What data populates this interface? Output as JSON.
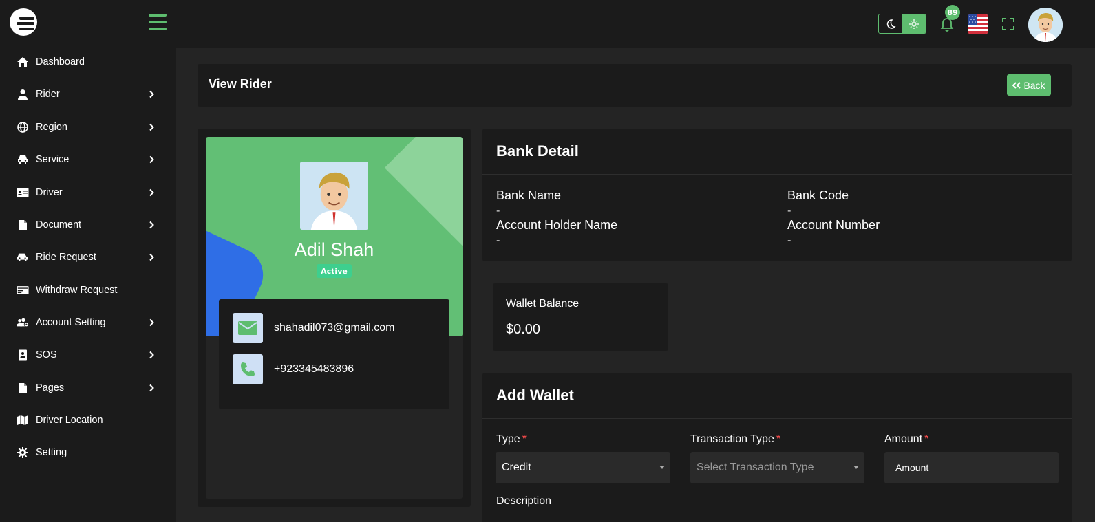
{
  "header": {
    "notification_count": "89",
    "language": "English (US)"
  },
  "sidebar": {
    "items": [
      {
        "label": "Dashboard",
        "icon": "home-icon",
        "has_submenu": false
      },
      {
        "label": "Rider",
        "icon": "user-icon",
        "has_submenu": true
      },
      {
        "label": "Region",
        "icon": "globe-icon",
        "has_submenu": true
      },
      {
        "label": "Service",
        "icon": "car-icon",
        "has_submenu": true
      },
      {
        "label": "Driver",
        "icon": "id-card-icon",
        "has_submenu": true
      },
      {
        "label": "Document",
        "icon": "file-icon",
        "has_submenu": true
      },
      {
        "label": "Ride Request",
        "icon": "taxi-icon",
        "has_submenu": true
      },
      {
        "label": "Withdraw Request",
        "icon": "money-icon",
        "has_submenu": false
      },
      {
        "label": "Account Setting",
        "icon": "users-gear-icon",
        "has_submenu": true
      },
      {
        "label": "SOS",
        "icon": "contact-book-icon",
        "has_submenu": true
      },
      {
        "label": "Pages",
        "icon": "page-icon",
        "has_submenu": true
      },
      {
        "label": "Driver Location",
        "icon": "map-icon",
        "has_submenu": false
      },
      {
        "label": "Setting",
        "icon": "gear-icon",
        "has_submenu": false
      }
    ]
  },
  "page": {
    "title": "View Rider",
    "back_label": "Back"
  },
  "profile": {
    "name": "Adil Shah",
    "status": "Active",
    "email": "shahadil073@gmail.com",
    "phone": "+923345483896"
  },
  "bank": {
    "title": "Bank Detail",
    "bank_name_label": "Bank Name",
    "bank_name": "-",
    "bank_code_label": "Bank Code",
    "bank_code": "-",
    "holder_label": "Account Holder Name",
    "holder": "-",
    "account_number_label": "Account Number",
    "account_number": "-"
  },
  "wallet": {
    "label": "Wallet Balance",
    "balance": "$0.00"
  },
  "add_wallet": {
    "title": "Add Wallet",
    "type_label": "Type",
    "type_value": "Credit",
    "transaction_label": "Transaction Type",
    "transaction_placeholder": "Select Transaction Type",
    "amount_label": "Amount",
    "amount_placeholder": "Amount",
    "description_label": "Description",
    "required_mark": "*"
  },
  "colors": {
    "accent": "#5ebd6f",
    "background": "#242424",
    "card": "#1b1b1b",
    "status_active": "#3ecf8e"
  }
}
